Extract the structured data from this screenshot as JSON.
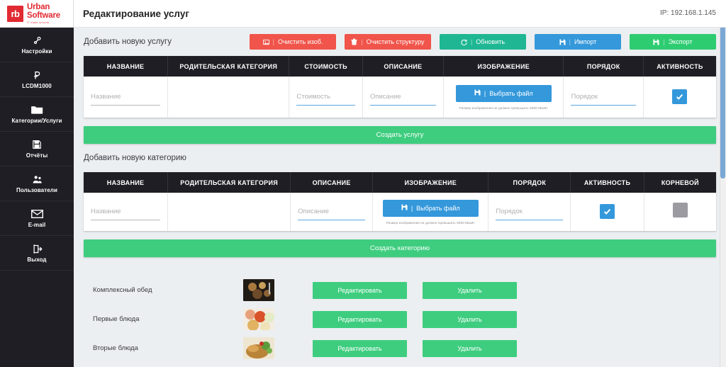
{
  "header": {
    "logo_mark": "rb",
    "logo_line1": "Urban",
    "logo_line2": "Software",
    "logo_tagline": "IT make smooth.",
    "page_title": "Редактирование услуг",
    "ip_label": "IP: 192.168.1.145"
  },
  "sidebar": {
    "items": [
      {
        "label": "Настройки",
        "icon": "settings-icon"
      },
      {
        "label": "LCDM1000",
        "icon": "ruble-icon"
      },
      {
        "label": "Категории/Услуги",
        "icon": "folder-icon"
      },
      {
        "label": "Отчёты",
        "icon": "save-icon"
      },
      {
        "label": "Пользователи",
        "icon": "users-icon"
      },
      {
        "label": "E-mail",
        "icon": "envelope-icon"
      },
      {
        "label": "Выход",
        "icon": "logout-icon"
      }
    ]
  },
  "service_section": {
    "title": "Добавить новую услугу",
    "toolbar": [
      {
        "label": "Очистить изоб.",
        "icon": "image-icon",
        "color": "#f0544a"
      },
      {
        "label": "Очистить структуру",
        "icon": "trash-icon",
        "color": "#f0544a"
      },
      {
        "label": "Обновить",
        "icon": "refresh-icon",
        "color": "#1fb793"
      },
      {
        "label": "Импорт",
        "icon": "floppy-icon",
        "color": "#3498db"
      },
      {
        "label": "Экспорт",
        "icon": "floppy-icon",
        "color": "#2ecc71"
      }
    ],
    "columns": [
      "НАЗВАНИЕ",
      "РОДИТЕЛЬСКАЯ КАТЕГОРИЯ",
      "СТОИМОСТЬ",
      "ОПИСАНИЕ",
      "ИЗОБРАЖЕНИЕ",
      "ПОРЯДОК",
      "АКТИВНОСТЬ"
    ],
    "fields": {
      "name_placeholder": "Название",
      "name_value": "",
      "parent_value": "",
      "price_placeholder": "Стоимость",
      "price_value": "",
      "description_placeholder": "Описание",
      "description_value": "",
      "file_button": "Выбрать файл",
      "file_hint": "Размер изображения не должен превышать 5000 КБайт",
      "order_placeholder": "Порядок",
      "order_value": "",
      "active_checked": true
    },
    "submit_label": "Создать услугу"
  },
  "category_section": {
    "title": "Добавить новую категорию",
    "columns": [
      "НАЗВАНИЕ",
      "РОДИТЕЛЬСКАЯ КАТЕГОРИЯ",
      "ОПИСАНИЕ",
      "ИЗОБРАЖЕНИЕ",
      "ПОРЯДОК",
      "АКТИВНОСТЬ",
      "КОРНЕВОЙ"
    ],
    "fields": {
      "name_placeholder": "Название",
      "name_value": "",
      "parent_value": "",
      "description_placeholder": "Описание",
      "description_value": "",
      "file_button": "Выбрать файл",
      "file_hint": "Размер изображения не должен превышать 5000 КБайт",
      "order_placeholder": "Порядок",
      "order_value": "",
      "active_checked": true,
      "root_checked": false
    },
    "submit_label": "Создать категорию"
  },
  "item_list": {
    "edit_label": "Редактировать",
    "delete_label": "Удалить",
    "rows": [
      {
        "name": "Комплексный обед",
        "thumb": "dark-meal-photo"
      },
      {
        "name": "Первые блюда",
        "thumb": "soups-photo"
      },
      {
        "name": "Вторые блюда",
        "thumb": "main-dish-photo"
      }
    ]
  },
  "colors": {
    "accent_red": "#e12a32",
    "sidebar_bg": "#1e1e24",
    "green": "#3ecd7f",
    "blue": "#3498db",
    "page_bg": "#eceff1"
  }
}
